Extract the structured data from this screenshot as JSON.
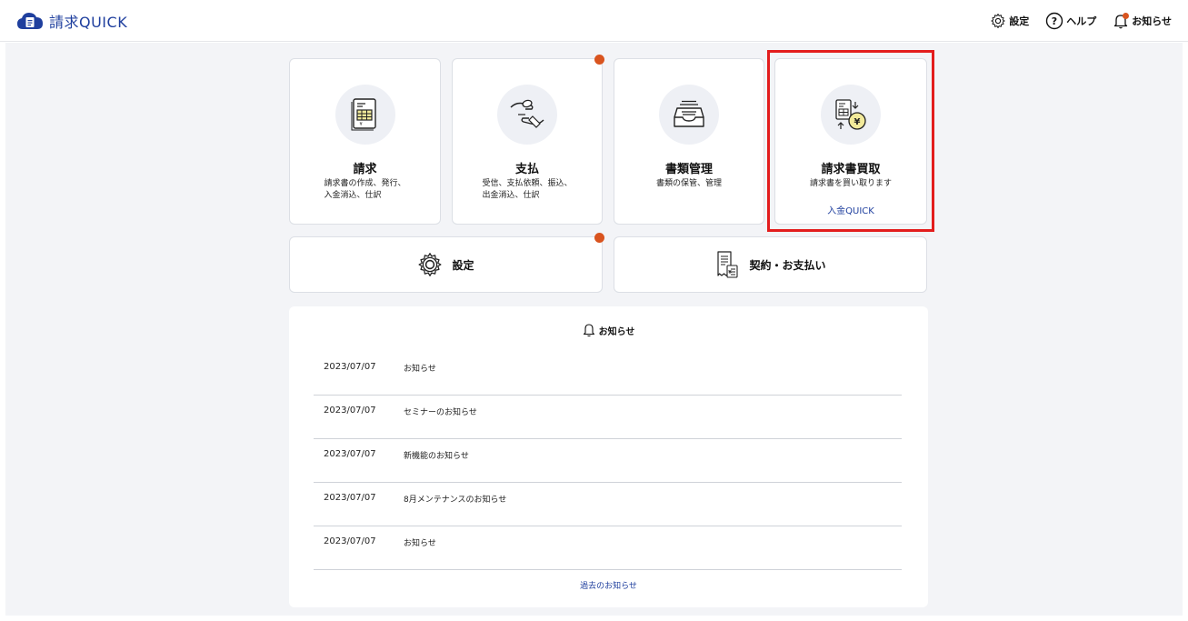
{
  "header": {
    "brand": "請求QUICK",
    "actions": {
      "settings": "設定",
      "help": "ヘルプ",
      "notifications": "お知らせ"
    }
  },
  "cards": [
    {
      "title": "請求",
      "desc_line1": "請求書の作成、発行、",
      "desc_line2": "入金消込、仕訳",
      "icon": "invoice-icon"
    },
    {
      "title": "支払",
      "desc_line1": "受信、支払依頼、振込、",
      "desc_line2": "出金消込、仕訳",
      "icon": "payment-hand-icon",
      "has_badge": true
    },
    {
      "title": "書類管理",
      "desc_line1": "書類の保管、管理",
      "icon": "document-tray-icon"
    },
    {
      "title": "請求書買取",
      "desc_line1": "請求書を買い取ります",
      "link": "入金QUICK",
      "icon": "invoice-purchase-icon"
    }
  ],
  "wide_cards": {
    "settings": {
      "label": "設定",
      "icon": "gear-icon",
      "has_badge": true
    },
    "contract": {
      "label": "契約・お支払い",
      "icon": "receipt-icon"
    }
  },
  "news": {
    "title": "お知らせ",
    "items": [
      {
        "date": "2023/07/07",
        "text": "お知らせ"
      },
      {
        "date": "2023/07/07",
        "text": "セミナーのお知らせ"
      },
      {
        "date": "2023/07/07",
        "text": "新機能のお知らせ"
      },
      {
        "date": "2023/07/07",
        "text": "8月メンテナンスのお知らせ"
      },
      {
        "date": "2023/07/07",
        "text": "お知らせ"
      }
    ],
    "more": "過去のお知らせ"
  },
  "colors": {
    "brand": "#1f3f9e",
    "badge": "#d9541f",
    "highlight": "#e31d1d",
    "background": "#f3f4f7"
  }
}
